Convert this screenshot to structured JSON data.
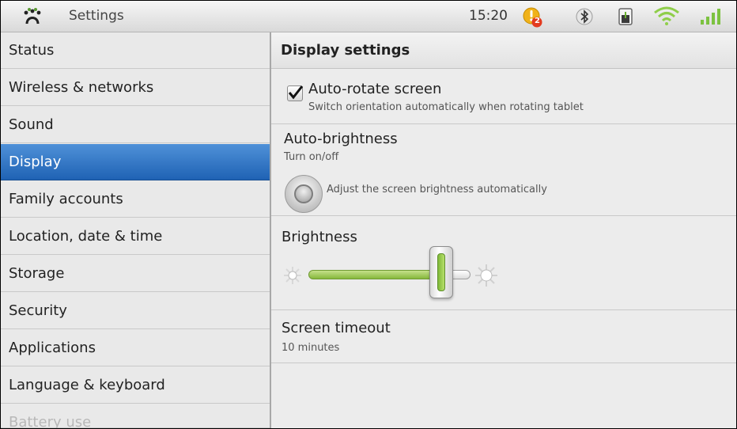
{
  "status_bar": {
    "app_title": "Settings",
    "time": "15:20",
    "icons": [
      "app-logo-icon",
      "warning-notification-icon",
      "bluetooth-icon",
      "battery-icon",
      "wifi-icon",
      "signal-icon"
    ],
    "notification_count": "2",
    "accent_color": "#e8a317"
  },
  "sidebar": {
    "items": [
      {
        "label": "Status"
      },
      {
        "label": "Wireless & networks"
      },
      {
        "label": "Sound"
      },
      {
        "label": "Display"
      },
      {
        "label": "Family accounts"
      },
      {
        "label": "Location, date & time"
      },
      {
        "label": "Storage"
      },
      {
        "label": "Security"
      },
      {
        "label": "Applications"
      },
      {
        "label": "Language & keyboard"
      },
      {
        "label": "Battery use"
      }
    ],
    "active_item": "Display",
    "active_color": "#2c6fc0"
  },
  "content": {
    "header": "Display settings",
    "auto_rotate": {
      "title": "Auto-rotate screen",
      "summary": "Switch orientation automatically when rotating tablet",
      "checked": true
    },
    "auto_brightness": {
      "title": "Auto-brightness",
      "summary": "Turn on/off",
      "toggle_label": "Adjust the screen brightness automatically"
    },
    "brightness": {
      "title": "Brightness",
      "level": 0.78,
      "slider_color": "#86b83c"
    },
    "screen_timeout": {
      "title": "Screen timeout",
      "value": "10 minutes"
    }
  }
}
